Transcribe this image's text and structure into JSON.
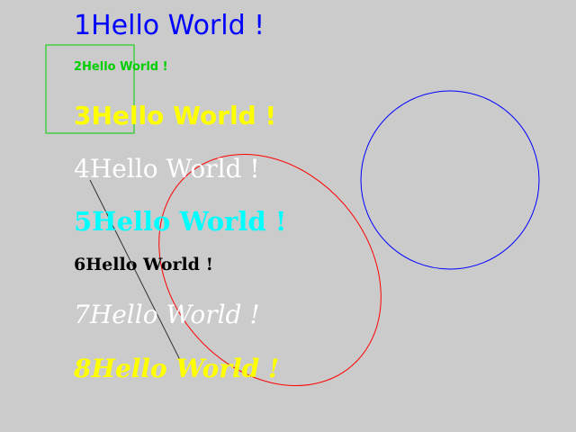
{
  "colors": {
    "background": "#cbcbcb",
    "blue": "#0000ff",
    "green": "#00ff00",
    "yellow": "#ffff00",
    "white": "#ffffff",
    "cyan": "#00ffff",
    "black": "#000000",
    "red": "#ff0000",
    "gray_line": "#333333"
  },
  "texts": [
    {
      "text": "1Hello World !",
      "color": "#0000ff"
    },
    {
      "text": "2Hello World !",
      "color": "#00d000"
    },
    {
      "text": "3Hello World !",
      "color": "#ffff00"
    },
    {
      "text": "4Hello World !",
      "color": "#ffffff"
    },
    {
      "text": "5Hello World !",
      "color": "#00ffff"
    },
    {
      "text": "6Hello World !",
      "color": "#000000"
    },
    {
      "text": "7Hello World !",
      "color": "#ffffff"
    },
    {
      "text": "8Hello World !",
      "color": "#ffff00"
    }
  ]
}
